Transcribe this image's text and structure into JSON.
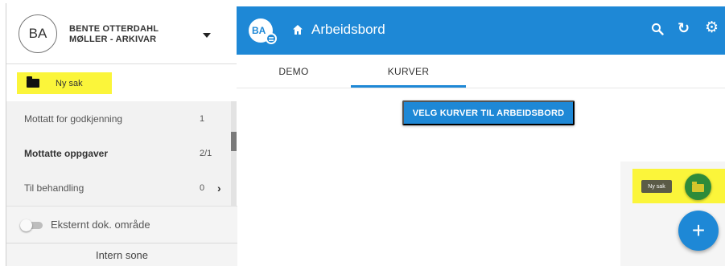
{
  "sidebar": {
    "avatar_initials": "BA",
    "user_name_line1": "BENTE OTTERDAHL",
    "user_name_line2": "MØLLER - ARKIVAR",
    "new_case_label": "Ny sak",
    "items": [
      {
        "label": "Mottatt for godkjenning",
        "count": "1"
      },
      {
        "label": "Mottatte oppgaver",
        "count": "2/1"
      },
      {
        "label": "Til behandling",
        "count": "0"
      }
    ],
    "toggle_label": "Eksternt dok. område",
    "zone_label": "Intern sone"
  },
  "header": {
    "logo_text": "BA",
    "title": "Arbeidsbord"
  },
  "tabs": [
    {
      "label": "DEMO"
    },
    {
      "label": "KURVER"
    }
  ],
  "main": {
    "select_charts_button": "VELG KURVER TIL ARBEIDSBORD",
    "mini_label": "Ny sak",
    "fab_add_symbol": "+"
  },
  "colors": {
    "primary": "#1e88d6",
    "highlight": "#fbf53a",
    "fab_green": "#2e8b3a"
  },
  "icons": {
    "header": [
      "home-icon",
      "search-icon",
      "refresh-icon",
      "gear-icon"
    ],
    "sidebar": [
      "chevron-down-icon",
      "folder-icon",
      "chevron-right-icon"
    ]
  }
}
